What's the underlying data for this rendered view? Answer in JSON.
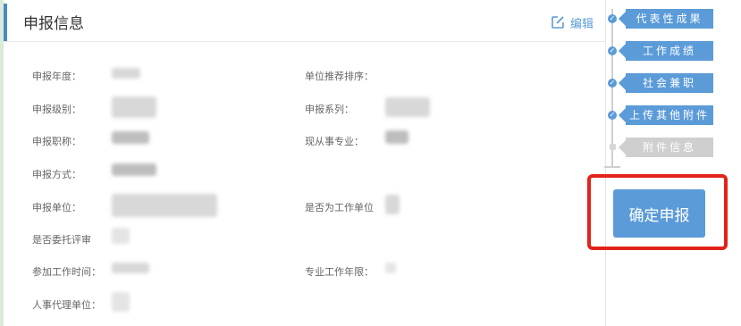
{
  "card": {
    "title": "申报信息",
    "edit_label": "编辑"
  },
  "fields": {
    "year": "申报年度：",
    "unit_rank": "单位推荐排序：",
    "level": "申报级别：",
    "series": "申报系列：",
    "title": "申报职称：",
    "major": "现从事专业：",
    "method": "申报方式：",
    "unit": "申报单位：",
    "is_work_unit": "是否为工作单位",
    "entrusted": "是否委托评审",
    "work_start": "参加工作时间：",
    "work_years": "专业工作年限：",
    "agency": "人事代理单位："
  },
  "steps": [
    {
      "label": "代表性成果",
      "status": "done"
    },
    {
      "label": "工作成绩",
      "status": "done"
    },
    {
      "label": "社会兼职",
      "status": "done"
    },
    {
      "label": "上传其他附件",
      "status": "done"
    },
    {
      "label": "附件信息",
      "status": "pending"
    }
  ],
  "action": {
    "confirm_label": "确定申报",
    "highlight_color": "#e2231a"
  },
  "colors": {
    "accent": "#5b9bd8",
    "inactive": "#cfcfcf"
  }
}
